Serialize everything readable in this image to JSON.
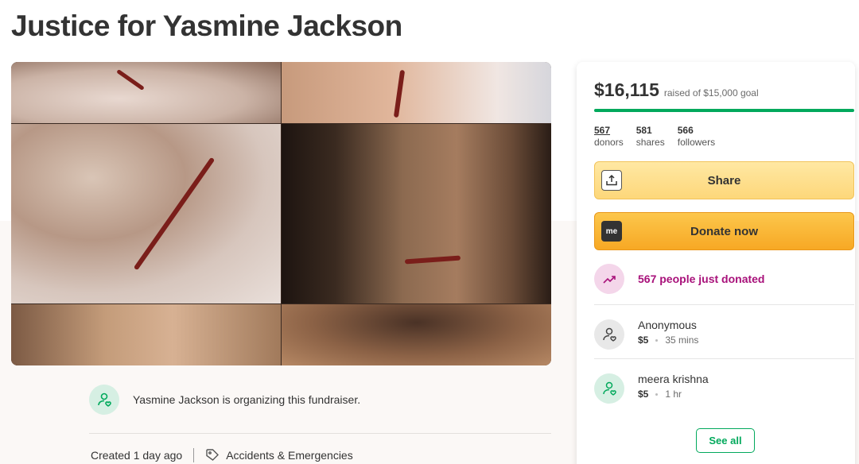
{
  "campaign": {
    "title": "Justice for Yasmine Jackson",
    "organizer_text": "Yasmine Jackson is organizing this fundraiser.",
    "created": "Created 1 day ago",
    "category": "Accidents & Emergencies"
  },
  "stats": {
    "raised": "$16,115",
    "goal_text": "raised of $15,000 goal",
    "progress_percent": 100,
    "donors_count": "567",
    "donors_label": "donors",
    "shares_count": "581",
    "shares_label": "shares",
    "followers_count": "566",
    "followers_label": "followers"
  },
  "actions": {
    "share_label": "Share",
    "donate_label": "Donate now",
    "donate_icon_text": "me",
    "see_all_label": "See all"
  },
  "trend_text": "567 people just donated",
  "donations": [
    {
      "name": "Anonymous",
      "amount": "$5",
      "time": "35 mins"
    },
    {
      "name": "meera krishna",
      "amount": "$5",
      "time": "1 hr"
    }
  ],
  "colors": {
    "brand_green": "#02a95c",
    "trend_purple": "#a8117a",
    "donate_orange": "#f7a824"
  },
  "icons": {
    "organizer": "user-heart-icon",
    "category": "tag-icon",
    "share": "share-upload-icon",
    "donate": "gofundme-icon",
    "trend": "trending-up-icon",
    "donor": "user-heart-icon"
  }
}
